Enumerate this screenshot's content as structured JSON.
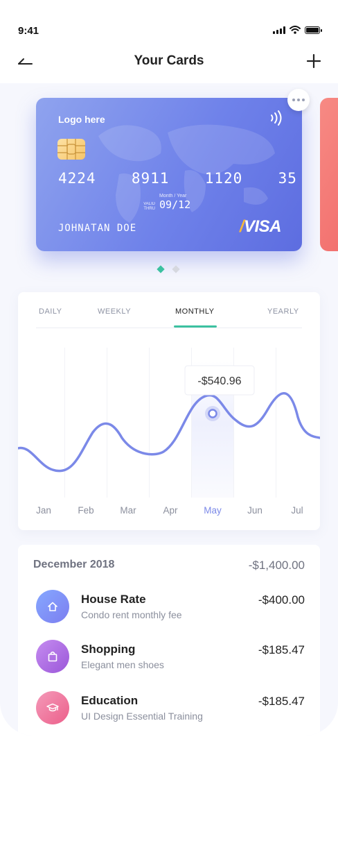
{
  "status": {
    "time": "9:41"
  },
  "nav": {
    "title": "Your Cards"
  },
  "card": {
    "logo": "Logo here",
    "number": "4224  8911  1120  35",
    "valid_label": "VALID THRU",
    "valid_hint": "Month / Year",
    "expiry": "09/12",
    "holder": "JOHNATAN DOE",
    "brand": "VISA",
    "gradient_start": "#8fa3ee",
    "gradient_end": "#5d6de0"
  },
  "pager": {
    "count": 2,
    "active": 0,
    "active_color": "#3cc1a0",
    "inactive_color": "#d6d8df"
  },
  "tabs": [
    {
      "label": "DAILY",
      "active": false
    },
    {
      "label": "WEEKLY",
      "active": false
    },
    {
      "label": "MONTHLY",
      "active": true
    },
    {
      "label": "YEARLY",
      "active": false
    }
  ],
  "chart_data": {
    "type": "line",
    "categories": [
      "Jan",
      "Feb",
      "Mar",
      "Apr",
      "May",
      "Jun",
      "Jul"
    ],
    "highlight_category": "May",
    "highlight_label": "-$540.96",
    "line_color": "#7b89e8",
    "grid": "vertical",
    "legend": "none"
  },
  "transactions": {
    "month": "December 2018",
    "total": "-$1,400.00",
    "items": [
      {
        "title": "House Rate",
        "subtitle": "Condo rent monthly fee",
        "amount": "-$400.00",
        "icon": "home-icon",
        "color_from": "#86a8ff",
        "color_to": "#7c7ef0"
      },
      {
        "title": "Shopping",
        "subtitle": "Elegant men shoes",
        "amount": "-$185.47",
        "icon": "shopping-bag-icon",
        "color_from": "#c58cf0",
        "color_to": "#9b57d9"
      },
      {
        "title": "Education",
        "subtitle": "UI Design Essential Training",
        "amount": "-$185.47",
        "icon": "graduation-cap-icon",
        "color_from": "#f49ab9",
        "color_to": "#ec5f8a"
      }
    ]
  }
}
